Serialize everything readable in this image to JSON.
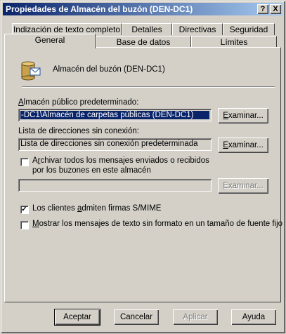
{
  "window": {
    "title": "Propiedades de Almacén del buzón (DEN-DC1)",
    "help_btn": "?",
    "close_btn": "X"
  },
  "tabs_row1": [
    "Indización de texto completo",
    "Detalles",
    "Directivas",
    "Seguridad"
  ],
  "tabs_row2": [
    "General",
    "Base de datos",
    "Límites"
  ],
  "general": {
    "store_name": "Almacén del buzón (DEN-DC1)",
    "public_store_label_u": "A",
    "public_store_label_rest": "lmacén público predeterminado:",
    "public_store_value": "-DC1\\Almacén de carpetas públicas (DEN-DC1)",
    "offline_label": "Lista de direcciones sin conexión:",
    "offline_value": "Lista de direcciones sin conexión predeterminada",
    "browse_u": "E",
    "browse_rest": "xaminar...",
    "archive_u": "r",
    "archive_line1_a": "A",
    "archive_line1_b": "chivar todos los mensajes enviados o recibidos",
    "archive_line2": "por los buzones en este almacén",
    "archive_checked": false,
    "smime_a": "Los clientes ",
    "smime_u": "a",
    "smime_b": "dmiten firmas S/MIME",
    "smime_checked": true,
    "plain_u": "M",
    "plain_rest": "ostrar los mensajes de texto sin formato en un tamaño de fuente fijo",
    "plain_checked": false
  },
  "buttons": {
    "accept": "Aceptar",
    "cancel": "Cancelar",
    "apply": "Aplicar",
    "help": "Ayuda"
  },
  "checkmark": "✓"
}
